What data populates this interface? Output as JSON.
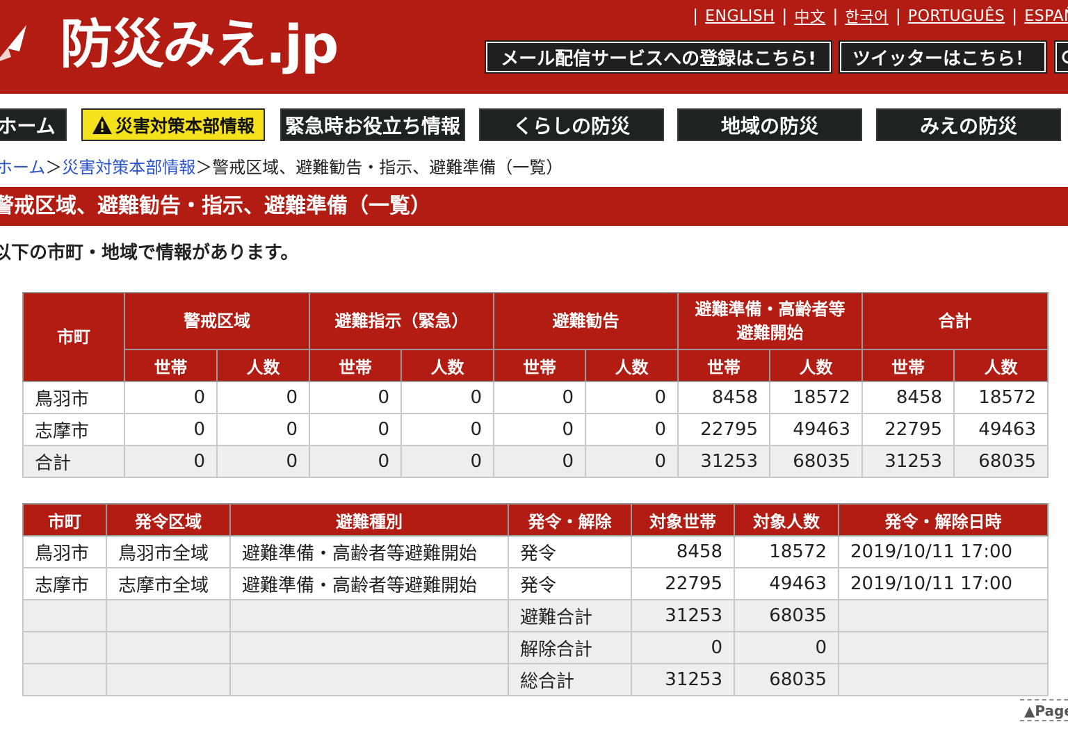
{
  "header": {
    "site_title": "防災みえ.jp",
    "languages": [
      "ENGLISH",
      "中文",
      "한국어",
      "PORTUGUÊS",
      "ESPAÑOL"
    ],
    "mail_button": "メール配信サービスへの登録はこちら!",
    "twitter_button": "ツイッターはこちら！"
  },
  "nav": {
    "items": [
      "ホーム",
      "災害対策本部情報",
      "緊急時お役立ち情報",
      "くらしの防災",
      "地域の防災",
      "みえの防災"
    ],
    "active_index": 1,
    "active_color": "#f5e21a"
  },
  "breadcrumb": {
    "home": "ホーム",
    "sep": "＞",
    "parent": "災害対策本部情報",
    "current": "警戒区域、避難勧告・指示、避難準備（一覧）"
  },
  "page": {
    "heading": "警戒区域、避難勧告・指示、避難準備（一覧）",
    "intro": "以下の市町・地域で情報があります。"
  },
  "summary_table": {
    "col_city": "市町",
    "groups": [
      "警戒区域",
      "避難指示（緊急）",
      "避難勧告",
      "避難準備・高齢者等避難開始",
      "合計"
    ],
    "sub_households": "世帯",
    "sub_people": "人数",
    "rows": [
      {
        "city": "鳥羽市",
        "values": [
          "0",
          "0",
          "0",
          "0",
          "0",
          "0",
          "8458",
          "18572",
          "8458",
          "18572"
        ]
      },
      {
        "city": "志摩市",
        "values": [
          "0",
          "0",
          "0",
          "0",
          "0",
          "0",
          "22795",
          "49463",
          "22795",
          "49463"
        ]
      },
      {
        "city": "合計",
        "values": [
          "0",
          "0",
          "0",
          "0",
          "0",
          "0",
          "31253",
          "68035",
          "31253",
          "68035"
        ]
      }
    ]
  },
  "detail_table": {
    "headers": [
      "市町",
      "発令区域",
      "避難種別",
      "発令・解除",
      "対象世帯",
      "対象人数",
      "発令・解除日時"
    ],
    "rows": [
      {
        "city": "鳥羽市",
        "area": "鳥羽市全域",
        "type": "避難準備・高齢者等避難開始",
        "status": "発令",
        "households": "8458",
        "people": "18572",
        "datetime": "2019/10/11 17:00"
      },
      {
        "city": "志摩市",
        "area": "志摩市全域",
        "type": "避難準備・高齢者等避難開始",
        "status": "発令",
        "households": "22795",
        "people": "49463",
        "datetime": "2019/10/11 17:00"
      }
    ],
    "totals": [
      {
        "label": "避難合計",
        "households": "31253",
        "people": "68035"
      },
      {
        "label": "解除合計",
        "households": "0",
        "people": "0"
      },
      {
        "label": "総合計",
        "households": "31253",
        "people": "68035"
      }
    ]
  },
  "page_top": "▲Page"
}
